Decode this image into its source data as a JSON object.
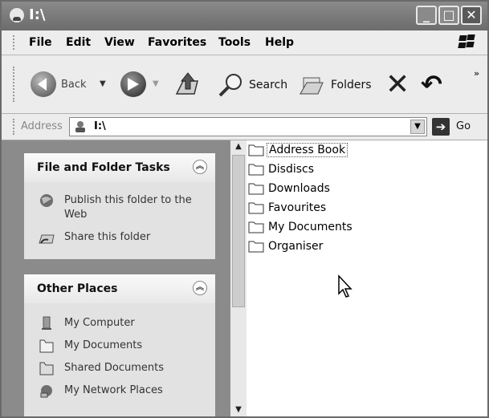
{
  "window": {
    "title": "I:\\"
  },
  "menu": [
    "File",
    "Edit",
    "View",
    "Favorites",
    "Tools",
    "Help"
  ],
  "toolbar": {
    "back_label": "Back",
    "search_label": "Search",
    "folders_label": "Folders",
    "chevron": "»"
  },
  "address": {
    "label": "Address",
    "value": "I:\\",
    "go_label": "Go"
  },
  "task_panels": [
    {
      "title": "File and Folder Tasks",
      "items": [
        {
          "label": "Publish this folder to the Web",
          "icon": "globe-icon"
        },
        {
          "label": "Share this folder",
          "icon": "share-folder-icon"
        }
      ]
    },
    {
      "title": "Other Places",
      "items": [
        {
          "label": "My Computer",
          "icon": "computer-icon"
        },
        {
          "label": "My Documents",
          "icon": "documents-folder-icon"
        },
        {
          "label": "Shared Documents",
          "icon": "shared-folder-icon"
        },
        {
          "label": "My Network Places",
          "icon": "network-icon"
        }
      ]
    }
  ],
  "folders": [
    "Address Book",
    "Disdiscs",
    "Downloads",
    "Favourites",
    "My Documents",
    "Organiser"
  ]
}
